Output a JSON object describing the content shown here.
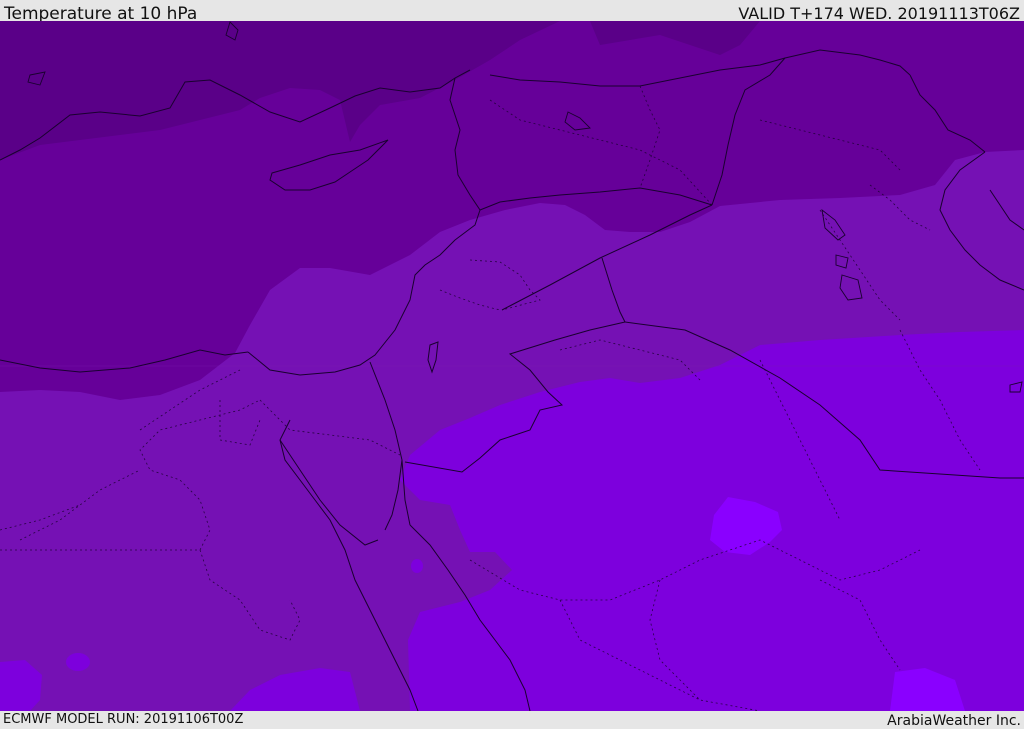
{
  "header": {
    "title": "Temperature at 10 hPa",
    "valid": "VALID T+174 WED. 20191113T06Z"
  },
  "footer": {
    "model_run": "ECMWF MODEL RUN: 20191106T00Z",
    "credit": "ArabiaWeather Inc."
  },
  "map": {
    "colors": {
      "darkest": "#5a0088",
      "dark": "#660099",
      "mid": "#7511b4",
      "bright": "#7d00dd",
      "brightest": "#8a00ff"
    }
  }
}
